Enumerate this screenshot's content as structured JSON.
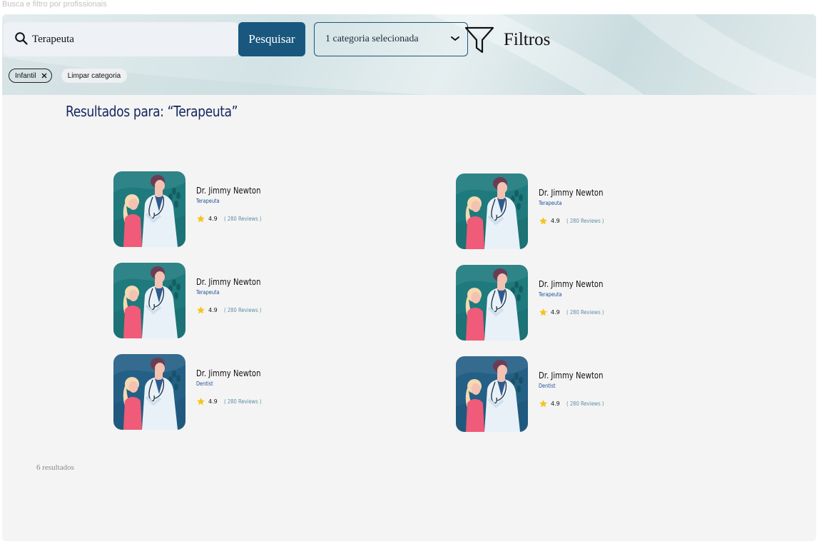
{
  "page_caption": "Busca e filtro por profissionais",
  "search": {
    "value": "Terapeuta",
    "button_label": "Pesquisar"
  },
  "category_select": {
    "selected": "1 categoria selecionada"
  },
  "filters": {
    "label": "Filtros"
  },
  "chips": {
    "active": "Infantil",
    "clear": "Limpar categoria"
  },
  "results": {
    "title": "Resultados para: “Terapeuta”",
    "count": "6 resultados",
    "cards": [
      {
        "name": "Dr. Jimmy Newton",
        "specialty": "Terapeuta",
        "rating": "4.9",
        "reviews": "( 280 Reviews )",
        "photo_bg": "#1e7a7d"
      },
      {
        "name": "Dr. Jimmy Newton",
        "specialty": "Terapeuta",
        "rating": "4.9",
        "reviews": "( 280 Reviews )",
        "photo_bg": "#1e7a7d"
      },
      {
        "name": "Dr. Jimmy Newton",
        "specialty": "Terapeuta",
        "rating": "4.9",
        "reviews": "( 280 Reviews )",
        "photo_bg": "#1e7a7d"
      },
      {
        "name": "Dr. Jimmy Newton",
        "specialty": "Terapeuta",
        "rating": "4.9",
        "reviews": "( 280 Reviews )",
        "photo_bg": "#1e7a7d"
      },
      {
        "name": "Dr. Jimmy Newton",
        "specialty": "Dentist",
        "rating": "4.9",
        "reviews": "( 280 Reviews )",
        "photo_bg": "#245f86"
      },
      {
        "name": "Dr. Jimmy Newton",
        "specialty": "Dentist",
        "rating": "4.9",
        "reviews": "( 280 Reviews )",
        "photo_bg": "#245f86"
      }
    ]
  },
  "colors": {
    "primary": "#19577e",
    "title": "#12275e",
    "star": "#f5c518",
    "reviews": "#5c8fa6"
  }
}
